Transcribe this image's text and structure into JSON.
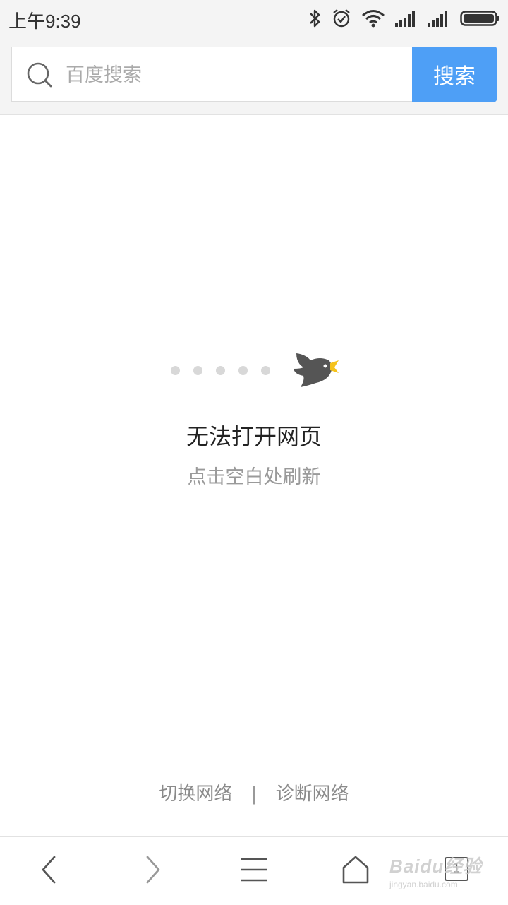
{
  "status_bar": {
    "time": "上午9:39",
    "icons": [
      "bluetooth-icon",
      "alarm-icon",
      "wifi-icon",
      "signal-icon",
      "signal-icon",
      "battery-icon"
    ]
  },
  "search": {
    "placeholder": "百度搜索",
    "button_label": "搜索",
    "accent_color": "#4e9ff6"
  },
  "error": {
    "title": "无法打开网页",
    "subtitle": "点击空白处刷新"
  },
  "network_links": {
    "switch_label": "切换网络",
    "separator": "|",
    "diagnose_label": "诊断网络"
  },
  "bottom_nav": {
    "icons": [
      "back-icon",
      "forward-icon",
      "menu-icon",
      "home-icon",
      "tabs-icon"
    ],
    "tab_count": "1"
  },
  "watermark": {
    "logo": "Baidu经验",
    "url": "jingyan.baidu.com"
  }
}
